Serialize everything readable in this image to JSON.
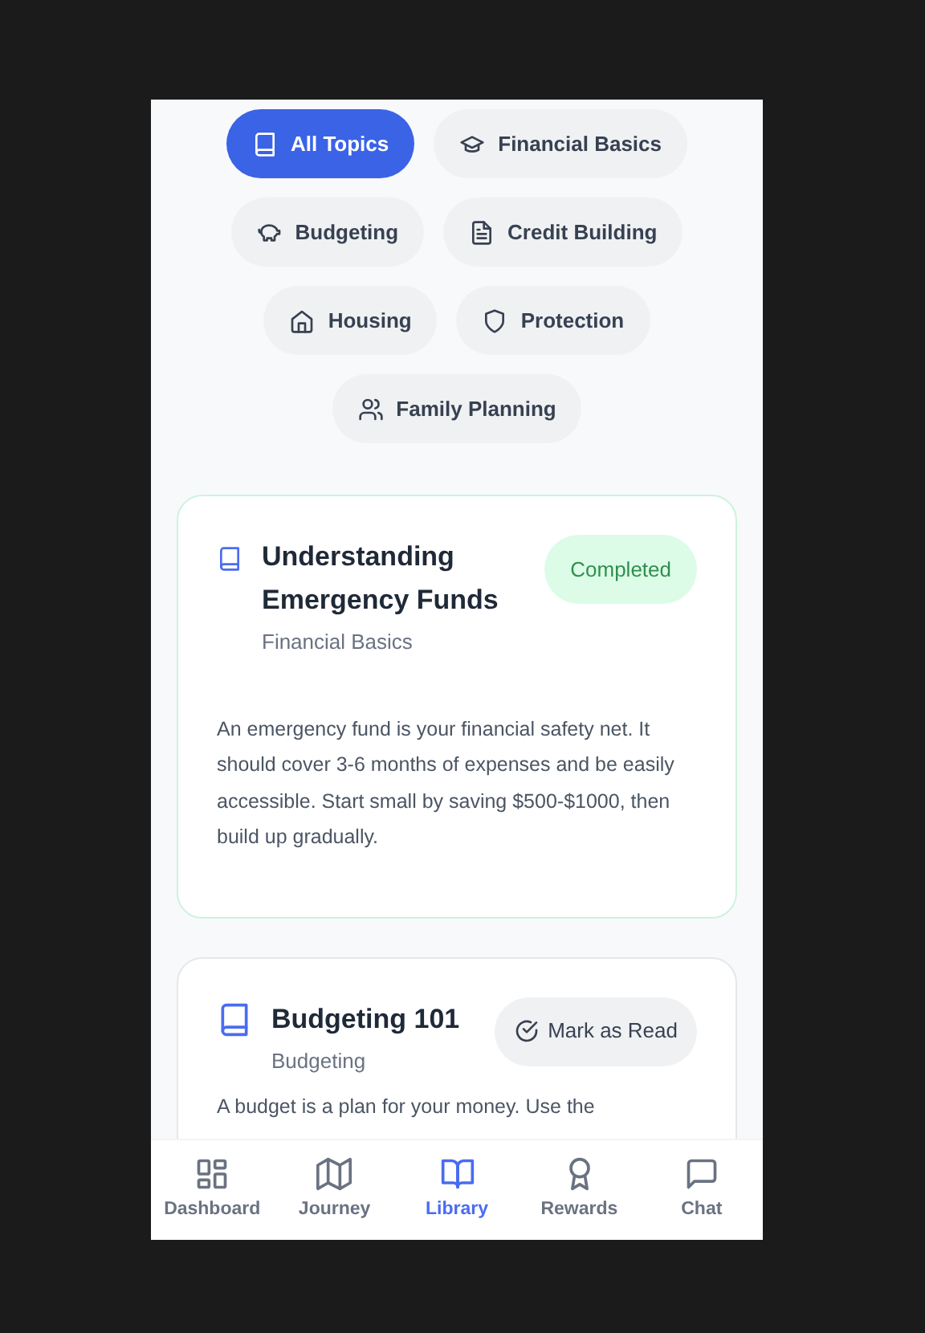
{
  "topics": [
    {
      "label": "All Topics",
      "selected": true
    },
    {
      "label": "Financial Basics",
      "selected": false
    },
    {
      "label": "Budgeting",
      "selected": false
    },
    {
      "label": "Credit Building",
      "selected": false
    },
    {
      "label": "Housing",
      "selected": false
    },
    {
      "label": "Protection",
      "selected": false
    },
    {
      "label": "Family Planning",
      "selected": false
    }
  ],
  "articles": [
    {
      "title": "Understanding Emergency Funds",
      "category": "Financial Basics",
      "completed": true,
      "status_label": "Completed",
      "body": "An emergency fund is your financial safety net. It should cover 3-6 months of expenses and be easily accessible. Start small by saving $500-$1000, then build up gradually."
    },
    {
      "title": "Budgeting 101",
      "category": "Budgeting",
      "completed": false,
      "status_label": "Mark as Read",
      "body": "A budget is a plan for your money. Use the"
    }
  ],
  "nav": [
    {
      "label": "Dashboard",
      "selected": false
    },
    {
      "label": "Journey",
      "selected": false
    },
    {
      "label": "Library",
      "selected": true
    },
    {
      "label": "Rewards",
      "selected": false
    },
    {
      "label": "Chat",
      "selected": false
    }
  ]
}
